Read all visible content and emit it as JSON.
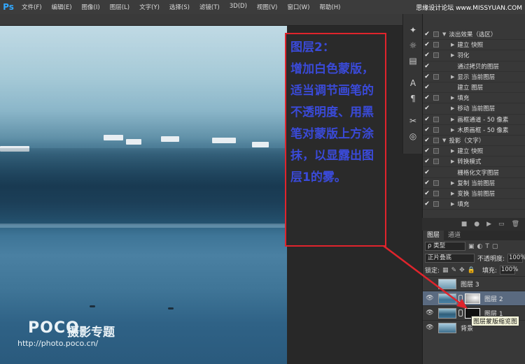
{
  "app": {
    "logo": "Ps"
  },
  "menu": [
    "文件(F)",
    "编辑(E)",
    "图像(I)",
    "图层(L)",
    "文字(Y)",
    "选择(S)",
    "滤镜(T)",
    "3D(D)",
    "视图(V)",
    "窗口(W)",
    "帮助(H)"
  ],
  "watermark_top": "思缘设计论坛 www.MISSYUAN.COM",
  "canvas": {
    "logo": "POCO",
    "title": "摄影专题",
    "url": "http://photo.poco.cn/"
  },
  "annotation": {
    "text": "图层2：\n增加白色蒙版，适当调节画笔的不透明度、用黑笔对蒙版上方涂抹，以显露出图层1的雾。",
    "color": "#e0242c"
  },
  "tools": [
    "settings-icon",
    "sun-icon",
    "layers-stack-icon",
    "text-icon",
    "paragraph-icon",
    "scissors-icon",
    "swirl-icon"
  ],
  "history": [
    {
      "label": "淡出效果（选区）",
      "expand": true,
      "box": true
    },
    {
      "label": "建立 快照",
      "expand": false,
      "box": true
    },
    {
      "label": "羽化",
      "expand": false,
      "box": true
    },
    {
      "label": "通过拷贝的图层",
      "expand": null,
      "box": false
    },
    {
      "label": "显示 当前图层",
      "expand": false,
      "box": true
    },
    {
      "label": "建立 图层",
      "expand": null,
      "box": false
    },
    {
      "label": "填充",
      "expand": false,
      "box": true
    },
    {
      "label": "移动 当前图层",
      "expand": false,
      "box": false
    },
    {
      "label": "画框通道 - 50 像素",
      "expand": false,
      "box": true
    },
    {
      "label": "木质画框 - 50 像素",
      "expand": false,
      "box": true
    },
    {
      "label": "投影（文字）",
      "expand": true,
      "box": true
    },
    {
      "label": "建立 快照",
      "expand": false,
      "box": true
    },
    {
      "label": "转换模式",
      "expand": false,
      "box": true
    },
    {
      "label": "栅格化文字图层",
      "expand": null,
      "box": false
    },
    {
      "label": "复制 当前图层",
      "expand": false,
      "box": true
    },
    {
      "label": "变换 当前图层",
      "expand": false,
      "box": true
    },
    {
      "label": "填充",
      "expand": false,
      "box": true
    }
  ],
  "layers_panel": {
    "tabs": [
      "图层",
      "通道"
    ],
    "filter": "ρ 类型",
    "blend_mode": "正片叠底",
    "opacity_label": "不透明度:",
    "opacity_value": "100%",
    "lock_label": "锁定:",
    "fill_label": "填充:",
    "fill_value": "100%",
    "layers": [
      {
        "name": "图层 3",
        "visible": false,
        "selected": false,
        "mask": false
      },
      {
        "name": "图层 2",
        "visible": true,
        "selected": true,
        "mask": true
      },
      {
        "name": "图层 1",
        "visible": true,
        "selected": false,
        "mask": true
      },
      {
        "name": "背景",
        "visible": true,
        "selected": false,
        "mask": false
      }
    ],
    "tooltip": "图层蒙版缩览图"
  }
}
